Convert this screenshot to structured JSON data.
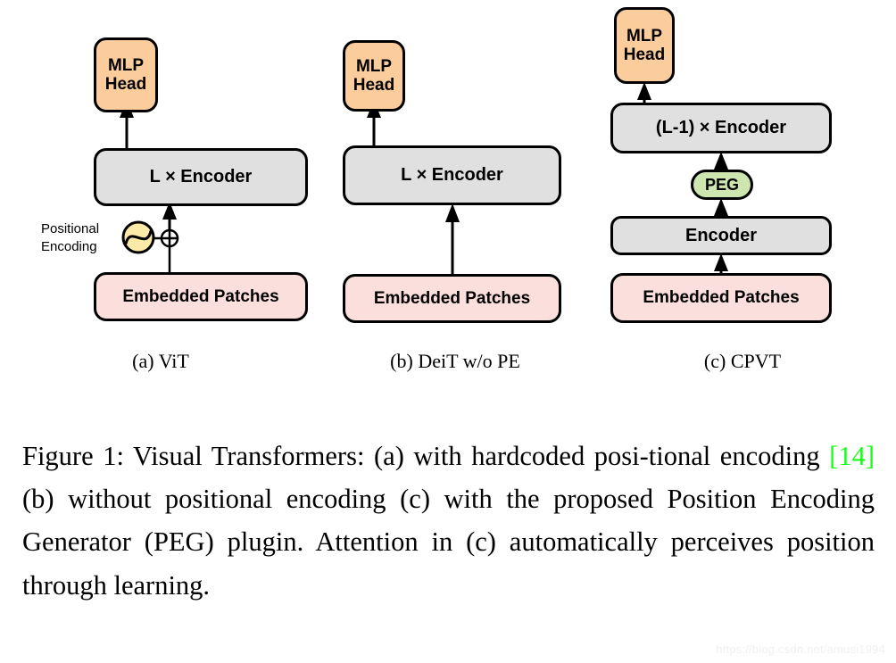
{
  "figure": {
    "panels": [
      {
        "id": "a",
        "sub_caption": "(a) ViT",
        "nodes": {
          "mlp_head": "MLP\nHead",
          "encoder": "L × Encoder",
          "embedded_patches": "Embedded Patches"
        },
        "annotations": {
          "positional_encoding": "Positional\nEncoding",
          "add_operator": "⊕",
          "sine_icon": "sine-wave-icon"
        }
      },
      {
        "id": "b",
        "sub_caption": "(b) DeiT w/o PE",
        "nodes": {
          "mlp_head": "MLP\nHead",
          "encoder": "L × Encoder",
          "embedded_patches": "Embedded Patches"
        }
      },
      {
        "id": "c",
        "sub_caption": "(c) CPVT",
        "nodes": {
          "mlp_head": "MLP\nHead",
          "encoder_top": "(L-1) × Encoder",
          "peg": "PEG",
          "encoder_bottom": "Encoder",
          "embedded_patches": "Embedded Patches"
        }
      }
    ],
    "caption": {
      "part1": "Figure 1:  Visual Transformers:  (a) with hardcoded posi-tional encoding ",
      "citation": "[14]",
      "part2": " (b) without positional encoding (c) with the proposed Position Encoding Generator (PEG) plugin.  Attention in (c) automatically perceives position through learning."
    },
    "watermark": "https://blog.csdn.net/amusi1994",
    "colors": {
      "orange": "#fbcc9c",
      "gray": "#e0e0e0",
      "pink": "#fadfdc",
      "green": "#cde6b0",
      "stroke": "#000000",
      "citation_green": "#1aff1a"
    }
  }
}
